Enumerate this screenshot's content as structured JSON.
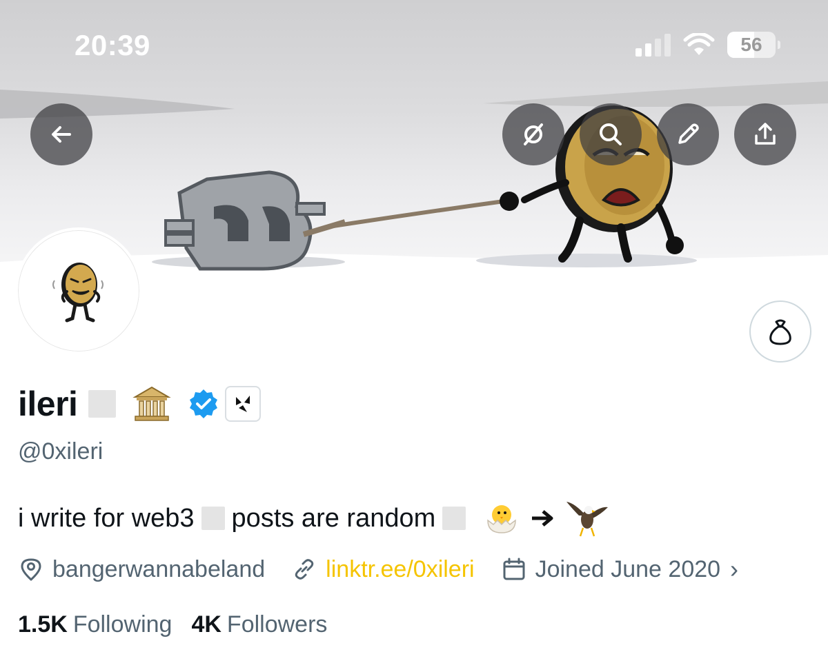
{
  "status_bar": {
    "time": "20:39",
    "battery": "56",
    "battery_level_percent": 56
  },
  "header_buttons": {
    "back_icon": "arrow-left-icon",
    "grok_icon": "grok-slash-icon",
    "search_icon": "search-icon",
    "edit_icon": "pencil-icon",
    "share_icon": "share-upload-icon",
    "tip_icon": "money-bag-icon"
  },
  "profile": {
    "display_name": "ileri",
    "handle": "@0xileri",
    "verified": true,
    "verified_color": "#1d9bf0",
    "bio": {
      "part1": "i write for web3",
      "part2": "posts are random",
      "emojis": [
        "hatching-chick",
        "right-arrow",
        "eagle"
      ]
    },
    "location": "bangerwannabeland",
    "link": "linktr.ee/0xileri",
    "link_color": "#f5c400",
    "joined": "Joined June 2020",
    "stats": {
      "following_count": "1.5K",
      "following_label": "Following",
      "followers_count": "4K",
      "followers_label": "Followers"
    }
  }
}
